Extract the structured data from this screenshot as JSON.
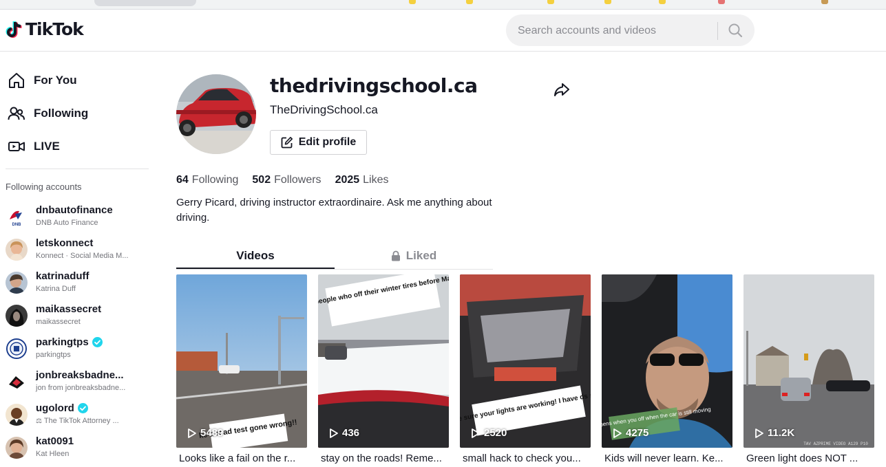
{
  "header": {
    "logo_text": "TikTok",
    "search_placeholder": "Search accounts and videos"
  },
  "sidebar": {
    "nav": [
      {
        "label": "For You",
        "icon": "home-icon"
      },
      {
        "label": "Following",
        "icon": "users-icon"
      },
      {
        "label": "LIVE",
        "icon": "live-camera-icon"
      }
    ],
    "following_title": "Following accounts",
    "accounts": [
      {
        "username": "dnbautofinance",
        "display": "DNB Auto Finance",
        "verified": false
      },
      {
        "username": "letskonnect",
        "display": "Konnect · Social Media M...",
        "verified": false
      },
      {
        "username": "katrinaduff",
        "display": "Katrina Duff",
        "verified": false
      },
      {
        "username": "maikassecret",
        "display": "maikassecret",
        "verified": false
      },
      {
        "username": "parkingtps",
        "display": "parkingtps",
        "verified": true
      },
      {
        "username": "jonbreaksbadne...",
        "display": "jon from jonbreaksbadne...",
        "verified": false
      },
      {
        "username": "ugolord",
        "display": "The TikTok Attorney ...",
        "verified": true
      },
      {
        "username": "kat0091",
        "display": "Kat Hleen",
        "verified": false
      }
    ]
  },
  "profile": {
    "username": "thedrivingschool.ca",
    "display_name": "TheDrivingSchool.ca",
    "edit_label": "Edit profile",
    "stats": [
      {
        "count": "64",
        "label": "Following"
      },
      {
        "count": "502",
        "label": "Followers"
      },
      {
        "count": "2025",
        "label": "Likes"
      }
    ],
    "bio": "Gerry Picard, driving instructor extraordinaire. Ask me anything about driving."
  },
  "tabs": {
    "videos": "Videos",
    "liked": "Liked"
  },
  "videos": [
    {
      "views": "5489",
      "caption": "Looks like a fail on the r...",
      "overlay": "ke a road test gone wrong!!"
    },
    {
      "views": "436",
      "caption": "stay on the roads! Reme...",
      "overlay": "To those people who off their winter tires before May, enjoy!"
    },
    {
      "views": "2520",
      "caption": "small hack to check you...",
      "overlay": "how to make sure your lights are working! I have ds so this works!"
    },
    {
      "views": "4275",
      "caption": "Kids will never learn. Ke...",
      "overlay": "What happens when you off when the car is still moving"
    },
    {
      "views": "11.2K",
      "caption": "Green light does NOT ...",
      "overlay": "TAV AZPRIME VIDEO A129 P10"
    }
  ],
  "colors": {
    "brand_cyan": "#25f4ee",
    "brand_red": "#fe2c55",
    "verified": "#20d5ec",
    "text": "#161823"
  }
}
